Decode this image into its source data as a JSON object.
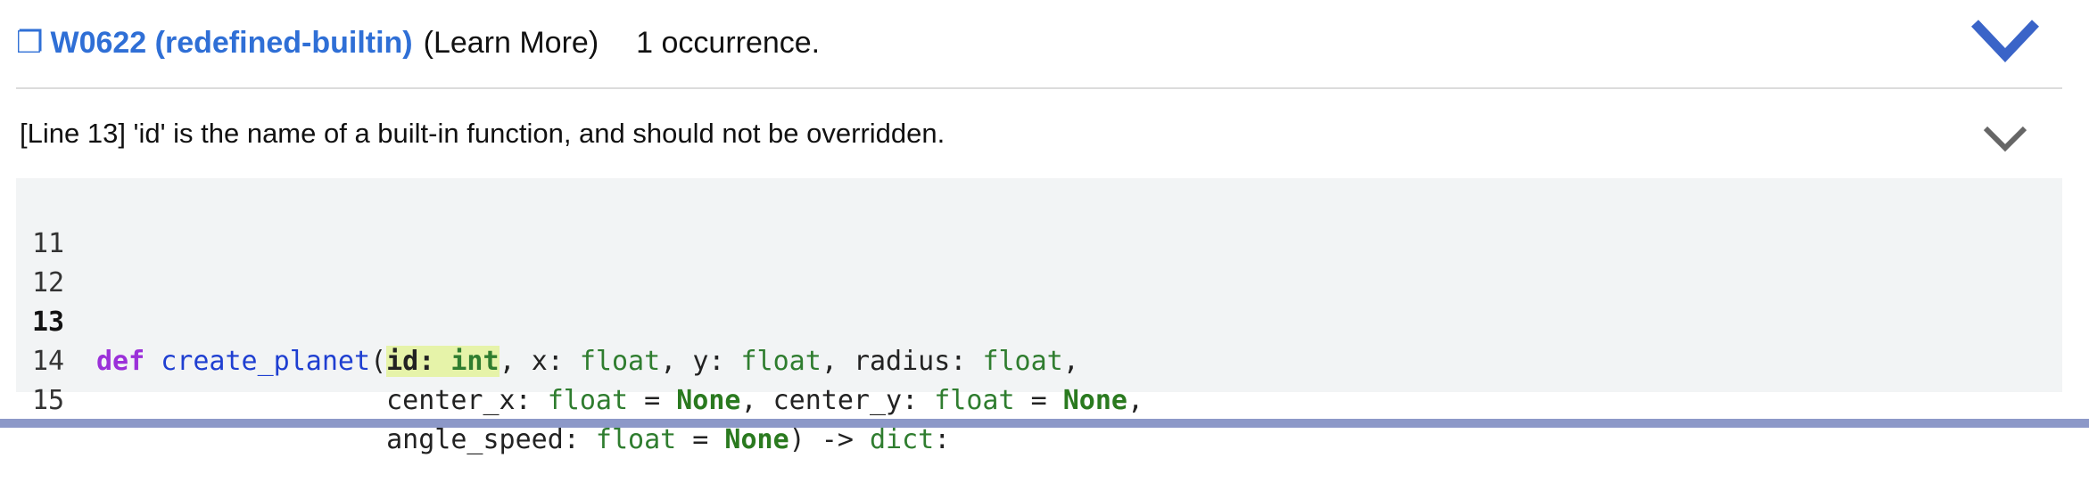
{
  "header": {
    "copy_icon": "copy-icon",
    "code_label": "W0622 (redefined-builtin)",
    "learn_more": "(Learn More)",
    "occurrences": "1 occurrence."
  },
  "message": "[Line 13] 'id' is the name of a built-in function, and should not be overridden.",
  "code": {
    "lines": [
      {
        "number": "11",
        "text": ""
      },
      {
        "number": "12",
        "text": ""
      },
      {
        "number": "13",
        "text": "def create_planet(id: int, x: float, y: float, radius: float,"
      },
      {
        "number": "14",
        "text": "                  center_x: float = None, center_y: float = None,"
      },
      {
        "number": "15",
        "text": "                  angle_speed: float = None) -> dict:"
      }
    ],
    "tokens": {
      "def": "def",
      "fname": "create_planet",
      "open_paren": "(",
      "id_name": "id",
      "colon_sp": ": ",
      "int": "int",
      "comma_sp": ", ",
      "x_name": "x",
      "y_name": "y",
      "radius_name": "radius",
      "float": "float",
      "comma_end": ",",
      "indent": "                  ",
      "center_x": "center_x",
      "center_y": "center_y",
      "eq": " = ",
      "none": "None",
      "angle_speed": "angle_speed",
      "close_arrow": ") -> ",
      "dict": "dict",
      "colon_end": ":"
    }
  },
  "colors": {
    "link": "#2f6fd6",
    "keyword": "#9b30d9",
    "function": "#1f3fd1",
    "type": "#2f7d2f",
    "highlight": "#e6f3a9",
    "code_bg": "#f2f4f5",
    "bottom_bar": "#8c98c8"
  }
}
